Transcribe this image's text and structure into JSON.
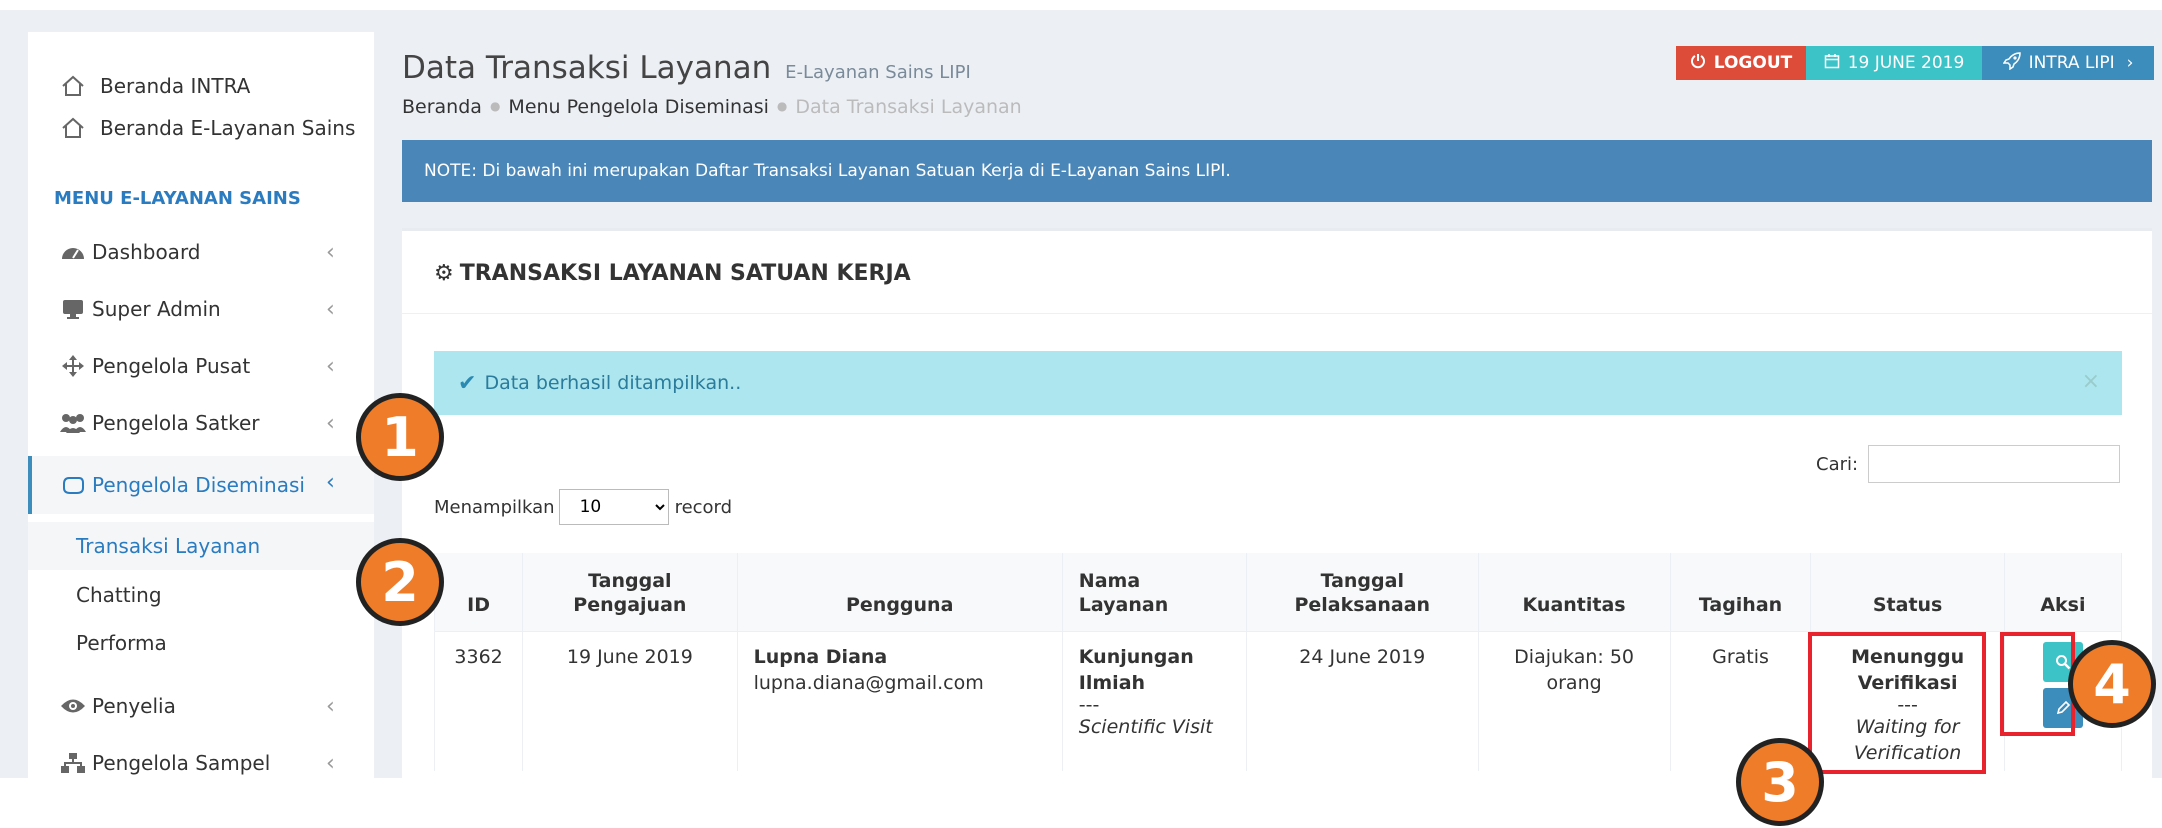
{
  "sidebar": {
    "top_links": [
      {
        "label": "Beranda INTRA",
        "icon": "home-icon"
      },
      {
        "label": "Beranda E-Layanan Sains",
        "icon": "home-icon"
      }
    ],
    "section_header": "MENU E-LAYANAN SAINS",
    "menu": [
      {
        "label": "Dashboard",
        "icon": "dashboard-icon"
      },
      {
        "label": "Super Admin",
        "icon": "monitor-icon"
      },
      {
        "label": "Pengelola Pusat",
        "icon": "arrows-icon"
      },
      {
        "label": "Pengelola Satker",
        "icon": "users-icon"
      },
      {
        "label": "Pengelola Diseminasi",
        "icon": "hand-icon"
      }
    ],
    "submenu": [
      "Transaksi Layanan",
      "Chatting",
      "Performa"
    ],
    "menu_bottom": [
      {
        "label": "Penyelia",
        "icon": "eye-icon"
      },
      {
        "label": "Pengelola Sampel",
        "icon": "sitemap-icon"
      }
    ]
  },
  "header": {
    "title": "Data Transaksi Layanan",
    "subtitle": "E-Layanan Sains LIPI",
    "breadcrumb": [
      "Beranda",
      "Menu Pengelola Diseminasi",
      "Data Transaksi Layanan"
    ],
    "logout_label": "LOGOUT",
    "date_label": "19 JUNE 2019",
    "intra_label": "INTRA LIPI"
  },
  "note": "NOTE: Di bawah ini merupakan Daftar Transaksi Layanan Satuan Kerja di E-Layanan Sains LIPI.",
  "box": {
    "title": "TRANSAKSI LAYANAN SATUAN KERJA",
    "alert": "Data berhasil ditampilkan..",
    "alert_close": "×",
    "length_prefix": "Menampilkan",
    "length_value": "10",
    "length_suffix": "record",
    "search_label": "Cari:"
  },
  "table": {
    "headers": {
      "id": "ID",
      "tanggal_pengajuan": [
        "Tanggal",
        "Pengajuan"
      ],
      "pengguna": "Pengguna",
      "nama_layanan": [
        "Nama",
        "Layanan"
      ],
      "tanggal_pelaksanaan": [
        "Tanggal",
        "Pelaksanaan"
      ],
      "kuantitas": "Kuantitas",
      "tagihan": "Tagihan",
      "status": "Status",
      "aksi": "Aksi"
    },
    "rows": [
      {
        "id": "3362",
        "tanggal_pengajuan": "19 June 2019",
        "pengguna_nama": "Lupna Diana",
        "pengguna_email": "lupna.diana@gmail.com",
        "layanan_line1": "Kunjungan",
        "layanan_line2": "Ilmiah",
        "layanan_sep": "---",
        "layanan_en": "Scientific Visit",
        "tanggal_pelaksanaan": "24 June 2019",
        "kuantitas_line1": "Diajukan: 50",
        "kuantitas_line2": "orang",
        "tagihan": "Gratis",
        "status_line1": "Menunggu",
        "status_line2": "Verifikasi",
        "status_sep": "---",
        "status_en_line1": "Waiting for",
        "status_en_line2": "Verification"
      }
    ]
  },
  "annotations": [
    "1",
    "2",
    "3",
    "4"
  ],
  "colors": {
    "primary": "#3c8dbc",
    "logout": "#dd4b39",
    "date": "#3cc3c8",
    "alert_bg": "#ade6ee",
    "marker": "#ee7c28",
    "highlight": "#e8232d"
  }
}
